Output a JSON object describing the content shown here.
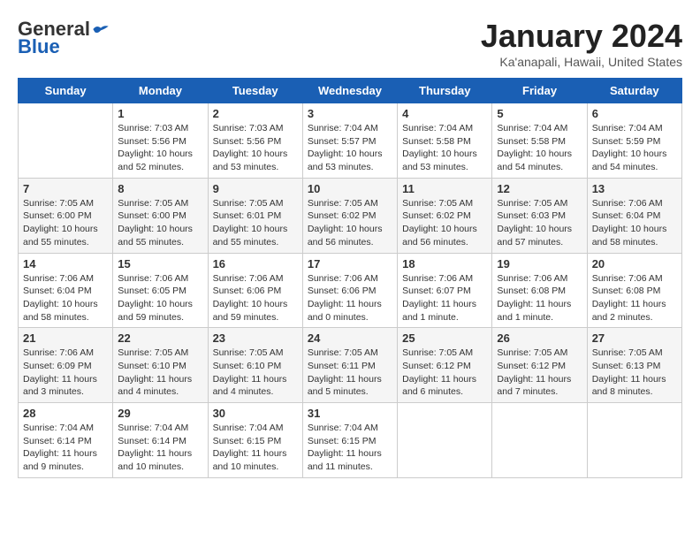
{
  "logo": {
    "general": "General",
    "blue": "Blue"
  },
  "header": {
    "title": "January 2024",
    "subtitle": "Ka'anapali, Hawaii, United States"
  },
  "days_of_week": [
    "Sunday",
    "Monday",
    "Tuesday",
    "Wednesday",
    "Thursday",
    "Friday",
    "Saturday"
  ],
  "weeks": [
    [
      {
        "day": null
      },
      {
        "day": 1,
        "sunrise": "Sunrise: 7:03 AM",
        "sunset": "Sunset: 5:56 PM",
        "daylight": "Daylight: 10 hours and 52 minutes."
      },
      {
        "day": 2,
        "sunrise": "Sunrise: 7:03 AM",
        "sunset": "Sunset: 5:56 PM",
        "daylight": "Daylight: 10 hours and 53 minutes."
      },
      {
        "day": 3,
        "sunrise": "Sunrise: 7:04 AM",
        "sunset": "Sunset: 5:57 PM",
        "daylight": "Daylight: 10 hours and 53 minutes."
      },
      {
        "day": 4,
        "sunrise": "Sunrise: 7:04 AM",
        "sunset": "Sunset: 5:58 PM",
        "daylight": "Daylight: 10 hours and 53 minutes."
      },
      {
        "day": 5,
        "sunrise": "Sunrise: 7:04 AM",
        "sunset": "Sunset: 5:58 PM",
        "daylight": "Daylight: 10 hours and 54 minutes."
      },
      {
        "day": 6,
        "sunrise": "Sunrise: 7:04 AM",
        "sunset": "Sunset: 5:59 PM",
        "daylight": "Daylight: 10 hours and 54 minutes."
      }
    ],
    [
      {
        "day": 7,
        "sunrise": "Sunrise: 7:05 AM",
        "sunset": "Sunset: 6:00 PM",
        "daylight": "Daylight: 10 hours and 55 minutes."
      },
      {
        "day": 8,
        "sunrise": "Sunrise: 7:05 AM",
        "sunset": "Sunset: 6:00 PM",
        "daylight": "Daylight: 10 hours and 55 minutes."
      },
      {
        "day": 9,
        "sunrise": "Sunrise: 7:05 AM",
        "sunset": "Sunset: 6:01 PM",
        "daylight": "Daylight: 10 hours and 55 minutes."
      },
      {
        "day": 10,
        "sunrise": "Sunrise: 7:05 AM",
        "sunset": "Sunset: 6:02 PM",
        "daylight": "Daylight: 10 hours and 56 minutes."
      },
      {
        "day": 11,
        "sunrise": "Sunrise: 7:05 AM",
        "sunset": "Sunset: 6:02 PM",
        "daylight": "Daylight: 10 hours and 56 minutes."
      },
      {
        "day": 12,
        "sunrise": "Sunrise: 7:05 AM",
        "sunset": "Sunset: 6:03 PM",
        "daylight": "Daylight: 10 hours and 57 minutes."
      },
      {
        "day": 13,
        "sunrise": "Sunrise: 7:06 AM",
        "sunset": "Sunset: 6:04 PM",
        "daylight": "Daylight: 10 hours and 58 minutes."
      }
    ],
    [
      {
        "day": 14,
        "sunrise": "Sunrise: 7:06 AM",
        "sunset": "Sunset: 6:04 PM",
        "daylight": "Daylight: 10 hours and 58 minutes."
      },
      {
        "day": 15,
        "sunrise": "Sunrise: 7:06 AM",
        "sunset": "Sunset: 6:05 PM",
        "daylight": "Daylight: 10 hours and 59 minutes."
      },
      {
        "day": 16,
        "sunrise": "Sunrise: 7:06 AM",
        "sunset": "Sunset: 6:06 PM",
        "daylight": "Daylight: 10 hours and 59 minutes."
      },
      {
        "day": 17,
        "sunrise": "Sunrise: 7:06 AM",
        "sunset": "Sunset: 6:06 PM",
        "daylight": "Daylight: 11 hours and 0 minutes."
      },
      {
        "day": 18,
        "sunrise": "Sunrise: 7:06 AM",
        "sunset": "Sunset: 6:07 PM",
        "daylight": "Daylight: 11 hours and 1 minute."
      },
      {
        "day": 19,
        "sunrise": "Sunrise: 7:06 AM",
        "sunset": "Sunset: 6:08 PM",
        "daylight": "Daylight: 11 hours and 1 minute."
      },
      {
        "day": 20,
        "sunrise": "Sunrise: 7:06 AM",
        "sunset": "Sunset: 6:08 PM",
        "daylight": "Daylight: 11 hours and 2 minutes."
      }
    ],
    [
      {
        "day": 21,
        "sunrise": "Sunrise: 7:06 AM",
        "sunset": "Sunset: 6:09 PM",
        "daylight": "Daylight: 11 hours and 3 minutes."
      },
      {
        "day": 22,
        "sunrise": "Sunrise: 7:05 AM",
        "sunset": "Sunset: 6:10 PM",
        "daylight": "Daylight: 11 hours and 4 minutes."
      },
      {
        "day": 23,
        "sunrise": "Sunrise: 7:05 AM",
        "sunset": "Sunset: 6:10 PM",
        "daylight": "Daylight: 11 hours and 4 minutes."
      },
      {
        "day": 24,
        "sunrise": "Sunrise: 7:05 AM",
        "sunset": "Sunset: 6:11 PM",
        "daylight": "Daylight: 11 hours and 5 minutes."
      },
      {
        "day": 25,
        "sunrise": "Sunrise: 7:05 AM",
        "sunset": "Sunset: 6:12 PM",
        "daylight": "Daylight: 11 hours and 6 minutes."
      },
      {
        "day": 26,
        "sunrise": "Sunrise: 7:05 AM",
        "sunset": "Sunset: 6:12 PM",
        "daylight": "Daylight: 11 hours and 7 minutes."
      },
      {
        "day": 27,
        "sunrise": "Sunrise: 7:05 AM",
        "sunset": "Sunset: 6:13 PM",
        "daylight": "Daylight: 11 hours and 8 minutes."
      }
    ],
    [
      {
        "day": 28,
        "sunrise": "Sunrise: 7:04 AM",
        "sunset": "Sunset: 6:14 PM",
        "daylight": "Daylight: 11 hours and 9 minutes."
      },
      {
        "day": 29,
        "sunrise": "Sunrise: 7:04 AM",
        "sunset": "Sunset: 6:14 PM",
        "daylight": "Daylight: 11 hours and 10 minutes."
      },
      {
        "day": 30,
        "sunrise": "Sunrise: 7:04 AM",
        "sunset": "Sunset: 6:15 PM",
        "daylight": "Daylight: 11 hours and 10 minutes."
      },
      {
        "day": 31,
        "sunrise": "Sunrise: 7:04 AM",
        "sunset": "Sunset: 6:15 PM",
        "daylight": "Daylight: 11 hours and 11 minutes."
      },
      {
        "day": null
      },
      {
        "day": null
      },
      {
        "day": null
      }
    ]
  ]
}
